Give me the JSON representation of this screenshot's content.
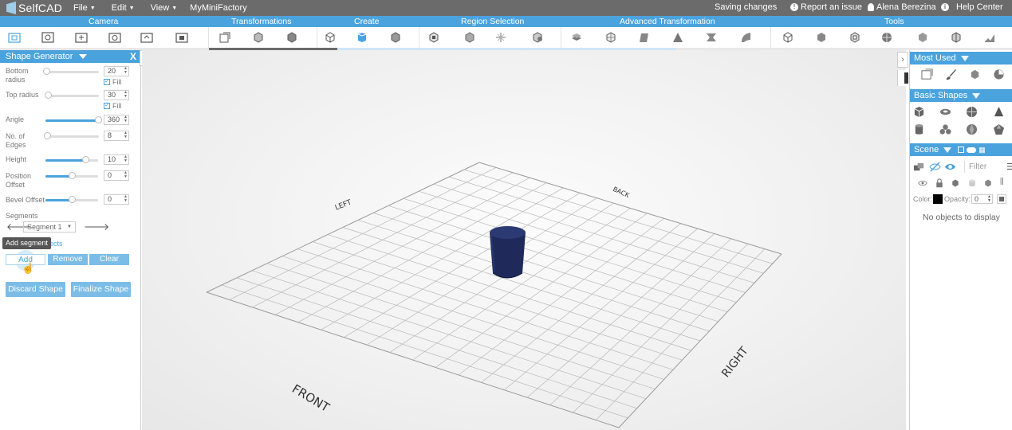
{
  "app": {
    "name": "SelfCAD",
    "project_name": "MyMiniFactory",
    "status": "Saving changes"
  },
  "menus": [
    {
      "label": "File"
    },
    {
      "label": "Edit"
    },
    {
      "label": "View"
    }
  ],
  "top_links": {
    "report": "Report an issue",
    "user": "Alena Berezina",
    "help": "Help Center"
  },
  "categories": [
    "Camera",
    "Transformations",
    "Create",
    "Region Selection",
    "Advanced Transformation",
    "Tools"
  ],
  "shape_generator": {
    "title": "Shape Generator",
    "close": "X",
    "fill_label": "Fill",
    "params": {
      "bottom_radius": {
        "label": "Bottom radius",
        "value": "20",
        "level": 0.0
      },
      "top_radius": {
        "label": "Top radius",
        "value": "30",
        "level": 0.0
      },
      "angle": {
        "label": "Angle",
        "value": "360",
        "level": 1.0
      },
      "edges": {
        "label": "No. of Edges",
        "value": "8",
        "level": 0.0
      },
      "height": {
        "label": "Height",
        "value": "10",
        "level": 0.75
      },
      "position_offset": {
        "label": "Position Offset",
        "value": "0",
        "level": 0.5
      },
      "bevel_offset": {
        "label": "Bevel Offset",
        "value": "0",
        "level": 0.5
      }
    },
    "segments_label": "Segments",
    "segment_selected": "Segment 1",
    "tooltip": "Add segment",
    "hidden_text": "ects",
    "add_label": "Add",
    "remove_label": "Remove",
    "clear_label": "Clear",
    "discard_label": "Discard Shape",
    "finalize_label": "Finalize Shape"
  },
  "viewport": {
    "labels": {
      "left": "LEFT",
      "back": "BACK",
      "front": "FRONT",
      "right": "RIGHT"
    },
    "object_color": "#1f2a5a"
  },
  "right_panel": {
    "most_used": "Most Used",
    "basic_shapes": "Basic Shapes",
    "scene": "Scene",
    "filter_placeholder": "Filter",
    "color_label": "Color:",
    "opacity_label": "Opacity:",
    "opacity_value": "0",
    "empty_text": "No objects to display"
  },
  "colors": {
    "accent": "#4aa3dc",
    "topbar": "#6b6b6b"
  }
}
